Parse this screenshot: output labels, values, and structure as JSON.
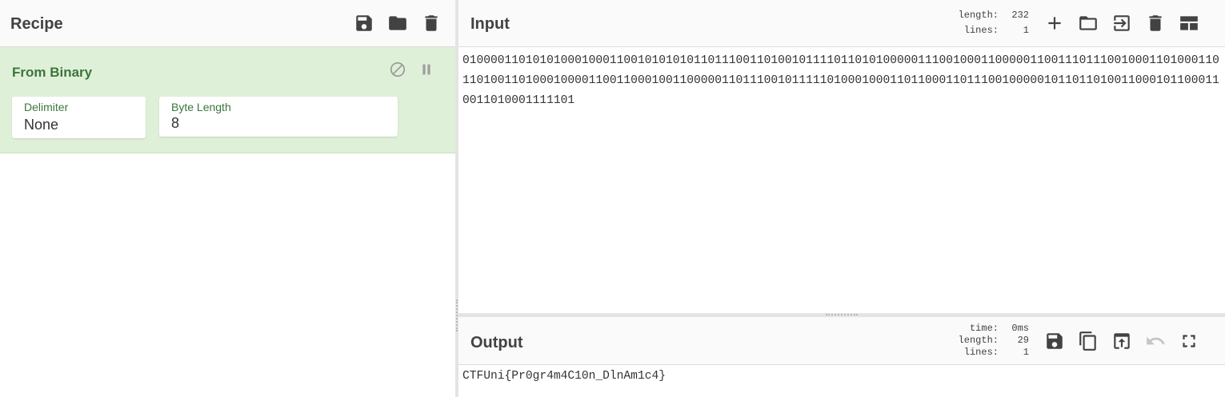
{
  "recipe": {
    "title": "Recipe",
    "icons": [
      "save-icon",
      "folder-icon",
      "trash-icon"
    ],
    "operation": {
      "name": "From Binary",
      "fields": [
        {
          "label": "Delimiter",
          "value": "None"
        },
        {
          "label": "Byte Length",
          "value": "8"
        }
      ]
    }
  },
  "input": {
    "title": "Input",
    "stats": {
      "length_label": "length:",
      "length_value": "232",
      "lines_label": "lines:",
      "lines_value": "1"
    },
    "text": "0100001101010100010001100101010101101110011010010111101101010000011100100011000001100111011100100011010001101101001101000100001100110001001100000110111001011111010001000110110001101110010000010110110100110001011000110011010001111101",
    "icons": [
      "add-icon",
      "folder-icon",
      "load-input-icon",
      "trash-icon",
      "layout-icon"
    ]
  },
  "output": {
    "title": "Output",
    "stats": {
      "time_label": "time:",
      "time_value": "0ms",
      "length_label": "length:",
      "length_value": "29",
      "lines_label": "lines:",
      "lines_value": "1"
    },
    "text": "CTFUni{Pr0gr4m4C10n_DlnAm1c4}",
    "icons": [
      "save-icon",
      "copy-icon",
      "open-in-input-icon",
      "undo-icon",
      "maximize-icon"
    ]
  }
}
